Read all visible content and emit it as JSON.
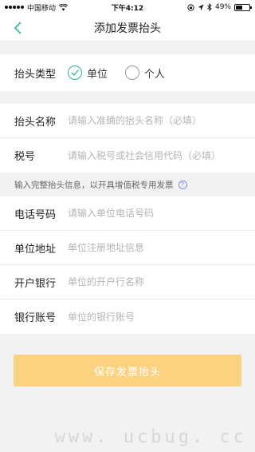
{
  "status_bar": {
    "carrier": "中国移动",
    "time": "下午4:12",
    "battery": "49%",
    "battery_level": 0.49
  },
  "nav": {
    "title": "添加发票抬头",
    "back_icon": "chevron-left-icon",
    "accent_color": "#2bb3a3"
  },
  "type_section": {
    "label": "抬头类型",
    "options": [
      {
        "label": "单位",
        "checked": true
      },
      {
        "label": "个人",
        "checked": false
      }
    ]
  },
  "basic_section": {
    "fields": [
      {
        "label": "抬头名称",
        "value": "",
        "placeholder": "请输入准确的抬头名称（必填）"
      },
      {
        "label": "税号",
        "value": "",
        "placeholder": "请输入税号或社会信用代码（必填）"
      }
    ]
  },
  "hint": {
    "text": "输入完整抬头信息，以开具增值税专用发票",
    "icon": "question-circle-icon"
  },
  "extra_section": {
    "fields": [
      {
        "label": "电话号码",
        "value": "",
        "placeholder": "请输入单位电话号码"
      },
      {
        "label": "单位地址",
        "value": "",
        "placeholder": "单位注册地址信息"
      },
      {
        "label": "开户银行",
        "value": "",
        "placeholder": "单位的开户行名称"
      },
      {
        "label": "银行账号",
        "value": "",
        "placeholder": "单位的银行账号"
      }
    ]
  },
  "save_button": {
    "label": "保存发票抬头",
    "color": "#fcd281"
  },
  "watermark": "www. ucbug. cc"
}
